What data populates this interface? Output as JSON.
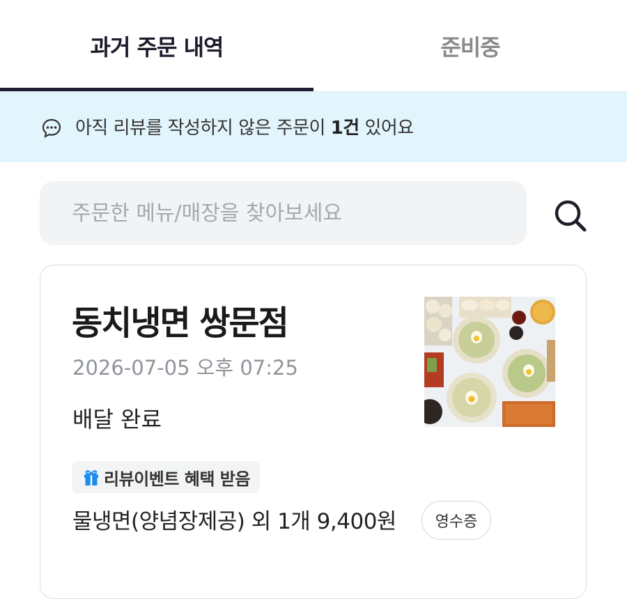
{
  "tabs": {
    "past_orders": "과거 주문 내역",
    "preparing": "준비중"
  },
  "banner": {
    "text_before": "아직 리뷰를 작성하지 않은 주문이 ",
    "count": "1건",
    "text_after": " 있어요",
    "icon": "chat-bubble-icon"
  },
  "search": {
    "placeholder": "주문한 메뉴/매장을 찾아보세요",
    "value": "",
    "icon": "search-icon"
  },
  "order": {
    "store_name": "동치냉면 쌍문점",
    "date": "2026-07-05 오후 07:25",
    "status": "배달 완료",
    "badge": {
      "label": "리뷰이벤트 혜택 받음",
      "icon": "gift-icon",
      "icon_color": "#1a8cf0"
    },
    "menu_summary": "물냉면(양념장제공) 외 1개 9,400원",
    "receipt_label": "영수증"
  },
  "colors": {
    "accent": "#1e1d33",
    "banner_bg": "#e3f5fc",
    "inactive_tab": "#8a8a8a"
  }
}
